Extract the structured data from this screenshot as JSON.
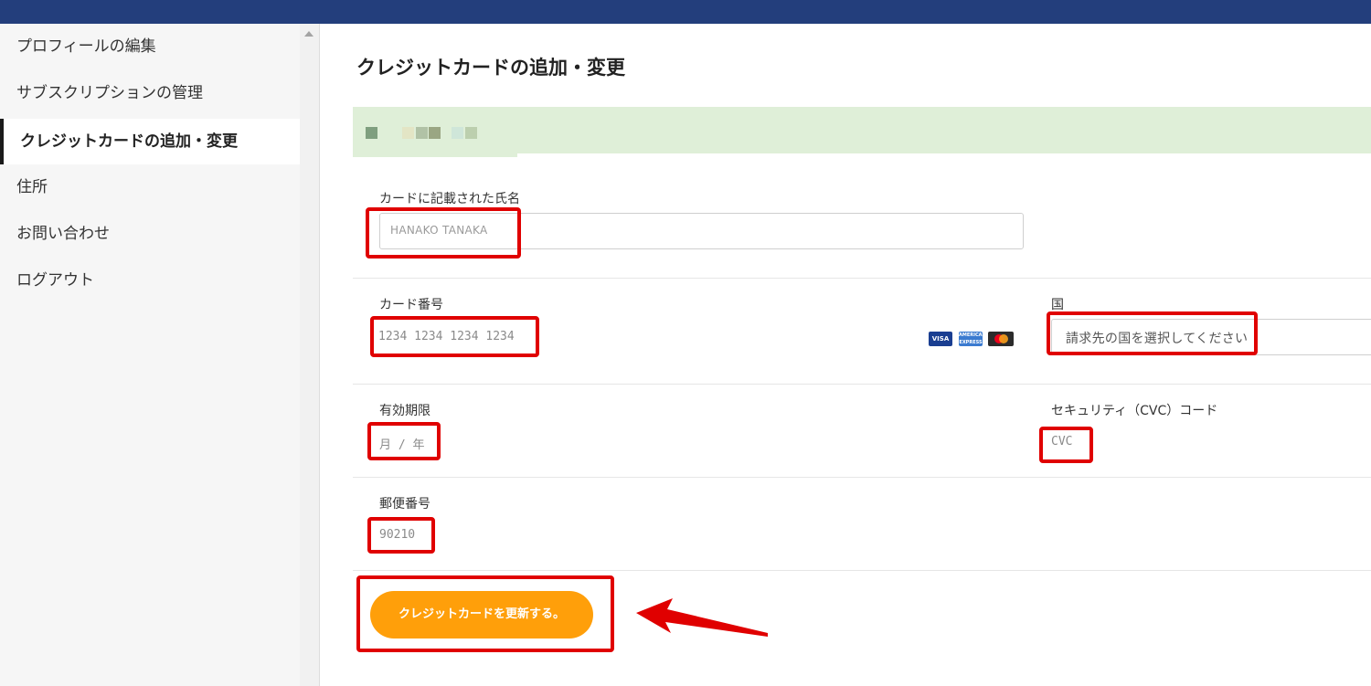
{
  "sidebar": {
    "items": [
      {
        "label": "プロフィールの編集"
      },
      {
        "label": "サブスクリプションの管理"
      },
      {
        "label": "クレジットカードの追加・変更"
      },
      {
        "label": "住所"
      },
      {
        "label": "お問い合わせ"
      },
      {
        "label": "ログアウト"
      }
    ]
  },
  "main": {
    "title": "クレジットカードの追加・変更",
    "form": {
      "name_label": "カードに記載された氏名",
      "name_placeholder": "HANAKO TANAKA",
      "card_number_label": "カード番号",
      "card_number_placeholder": "1234 1234 1234 1234",
      "country_label": "国",
      "country_placeholder": "請求先の国を選択してください",
      "expiry_label": "有効期限",
      "expiry_placeholder": "月 / 年",
      "cvc_label": "セキュリティ（CVC）コード",
      "cvc_placeholder": "CVC",
      "postal_label": "郵便番号",
      "postal_placeholder": "90210",
      "submit_label": "クレジットカードを更新する。"
    },
    "card_brands": [
      "visa-icon",
      "amex-icon",
      "mastercard-icon"
    ]
  },
  "colors": {
    "topbar": "#233e7c",
    "accent_button": "#ff9f0a",
    "annotation_red": "#e00000",
    "notice_bg": "#dfefd8"
  }
}
